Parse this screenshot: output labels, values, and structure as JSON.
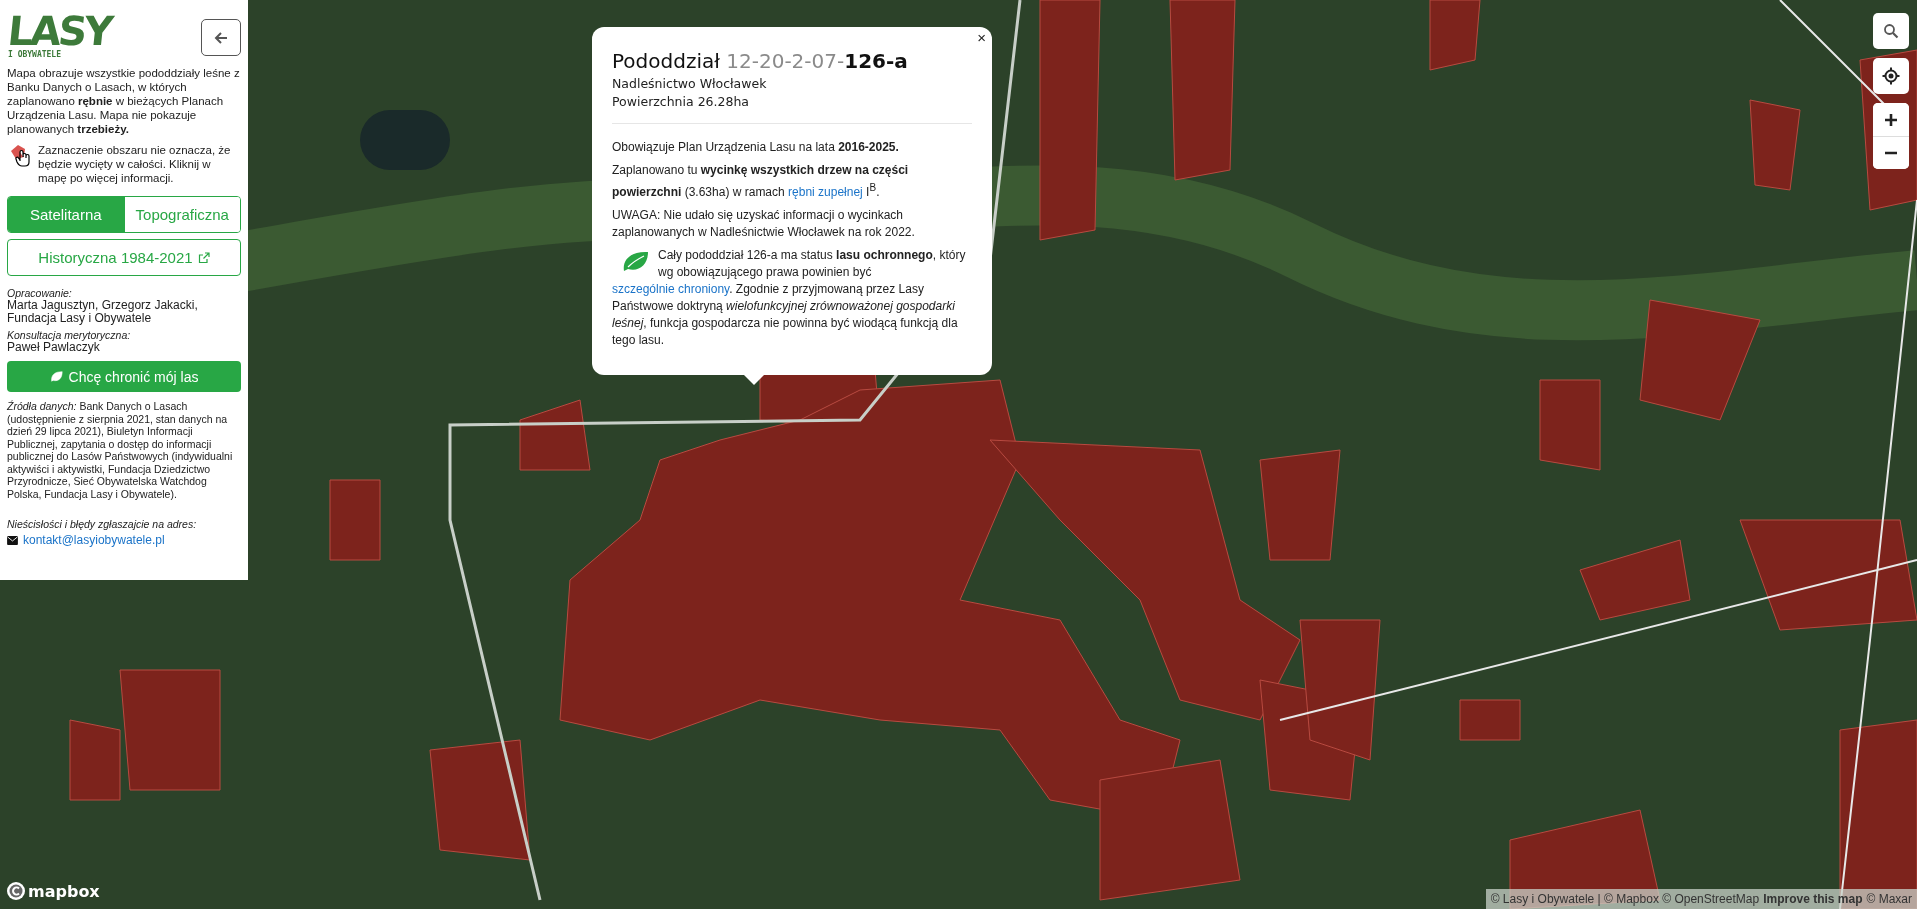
{
  "sidebar": {
    "logo": {
      "main": "LASY",
      "sub": "I OBYWATELE"
    },
    "intro": "Mapa obrazuje wszystkie pododdziały leśne z Banku Danych o Lasach, w których zaplanowano **rębnie** w bieżących Planach Urządzenia Lasu. Mapa nie pokazuje planowanych **trzebieży.**",
    "hint": "Zaznaczenie obszaru nie oznacza, że będzie wycięty w całości. Kliknij w mapę po więcej informacji.",
    "layer_tabs": [
      {
        "label": "Satelitarna",
        "selected": true
      },
      {
        "label": "Topograficzna",
        "selected": false
      }
    ],
    "history_link": "Historyczna 1984-2021",
    "credits": [
      {
        "heading": "Opracowanie:",
        "text": "Marta Jagusztyn, Grzegorz Jakacki, Fundacja Lasy i Obywatele"
      },
      {
        "heading": "Konsultacja merytoryczna:",
        "text": "Paweł Pawlaczyk"
      }
    ],
    "protect_button": "Chcę chronić mój las",
    "sources": "*Źródła danych:* Bank Danych o Lasach (udostępnienie z sierpnia 2021, stan danych na dzień 29 lipca 2021), Biuletyn Informacji Publicznej, zapytania o dostęp do informacji publicznej do Lasów Państwowych (indywidualni aktywiści i aktywistki, Fundacja Dziedzictwo Przyrodnicze, Sieć Obywatelska Watchdog Polska, Fundacja Lasy i Obywatele).",
    "contact": {
      "heading": "Nieścisłości i błędy zgłaszajcie na adres:",
      "email": "kontakt@lasyiobywatele.pl"
    }
  },
  "popup": {
    "close": "×",
    "title_prefix": "Pododdział",
    "title_code": "12-20-2-07-",
    "title_id": "126-a",
    "district": "Nadleśnictwo Włocławek",
    "area": "Powierzchnia 26.28ha",
    "paragraphs": [
      {
        "kind": "plain",
        "text": "Obowiązuje Plan Urządzenia Lasu na lata **2016-2025.**"
      },
      {
        "kind": "link",
        "before": "Zaplanowano tu **wycinkę wszystkich drzew na części powierzchni** (3.63ha) w ramach ",
        "link": "rębni zupełnej",
        "after": " I$^{B}$."
      },
      {
        "kind": "plain",
        "text": "UWAGA: Nie udało się uzyskać informacji o wycinkach zaplanowanych w Nadleśnictwie Włocławek na rok 2022."
      },
      {
        "kind": "leaf",
        "before": "Cały pododdział 126-a ma status **lasu ochronnego**, który wg obowiązującego prawa powinien być ",
        "link": "szczególnie chroniony",
        "after": ". Zgodnie z przyjmowaną przez Lasy Państwowe doktryną *wielofunkcyjnej zrównoważonej gospodarki leśnej*, funkcja gospodarcza nie powinna być wiodącą funkcją dla tego lasu."
      }
    ]
  },
  "attribution": {
    "prefix": "© Lasy i Obywatele | © Mapbox © OpenStreetMap",
    "improve_link": "Improve this map",
    "suffix": "© Maxar"
  },
  "mapbox_logo": "mapbox"
}
